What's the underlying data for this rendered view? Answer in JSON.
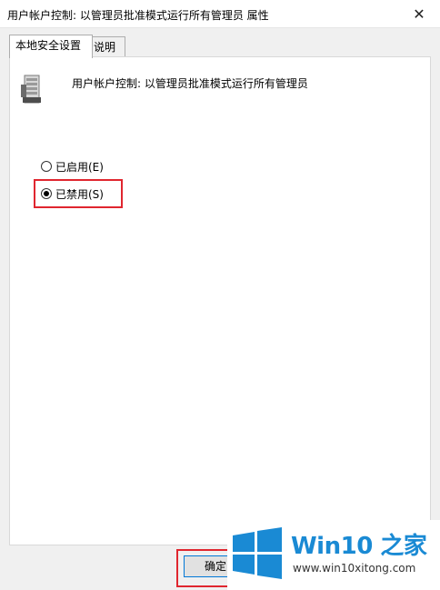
{
  "window": {
    "title": "用户帐户控制: 以管理员批准模式运行所有管理员 属性",
    "close_glyph": "✕"
  },
  "tabs": [
    {
      "label": "本地安全设置",
      "active": true
    },
    {
      "label": "说明",
      "active": false
    }
  ],
  "policy": {
    "name": "用户帐户控制: 以管理员批准模式运行所有管理员",
    "icon": "server-policy-icon"
  },
  "options": [
    {
      "label": "已启用(E)",
      "checked": false
    },
    {
      "label": "已禁用(S)",
      "checked": true
    }
  ],
  "buttons": {
    "ok_label": "确定"
  },
  "watermark": {
    "brand": "Win10 之家",
    "url": "www.win10xitong.com"
  },
  "colors": {
    "highlight": "#e0262f",
    "brand_blue": "#1a8ad4"
  }
}
